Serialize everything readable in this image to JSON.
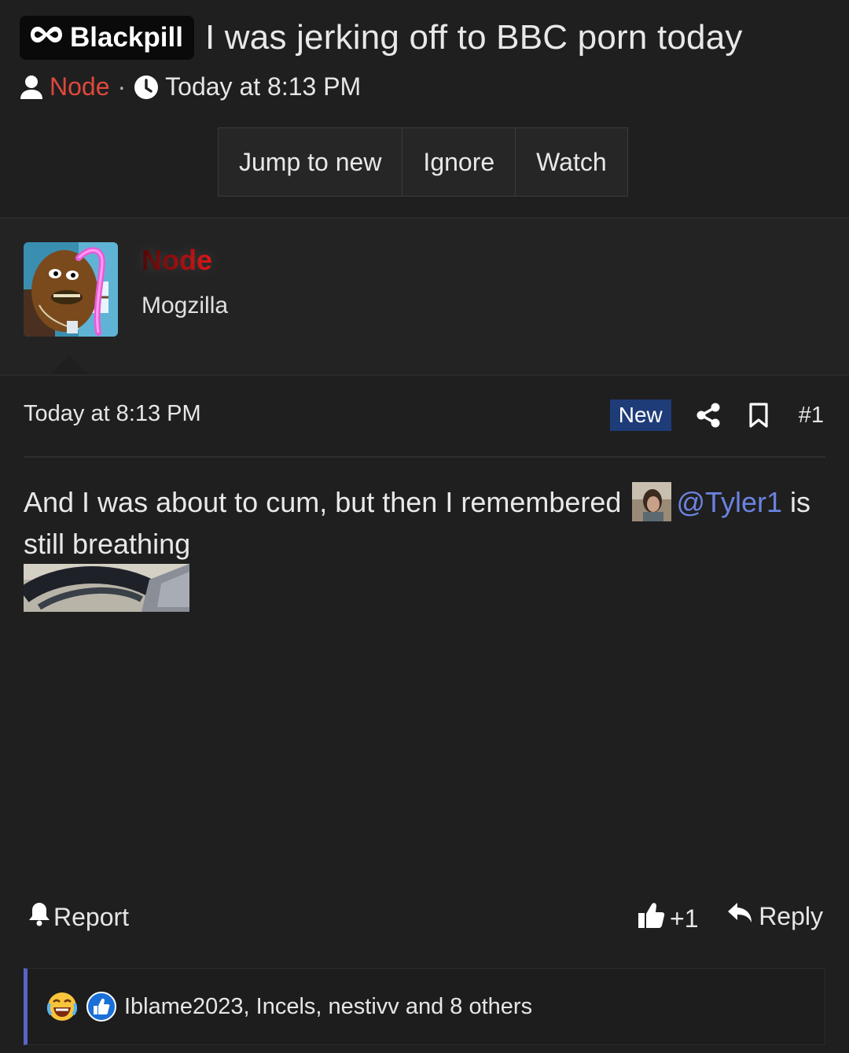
{
  "thread": {
    "prefix": "Blackpill",
    "title": "I was jerking off to BBC porn today",
    "author": "Node",
    "separator": "·",
    "time": "Today at 8:13 PM"
  },
  "buttons": {
    "jump": "Jump to new",
    "ignore": "Ignore",
    "watch": "Watch"
  },
  "author_block": {
    "name": "Node",
    "user_title": "Mogzilla"
  },
  "post": {
    "time": "Today at 8:13 PM",
    "new_badge": "New",
    "number": "#1",
    "text_before": "And I was about to cum, but then I remembered",
    "mention": "@Tyler1",
    "text_after": "is still breathing",
    "report": "Report",
    "like_count": "+1",
    "reply": "Reply",
    "reactions": "Iblame2023, Incels, nestivv and 8 others"
  },
  "colors": {
    "background": "#1f1f1f",
    "author_link": "#e0483c",
    "mention": "#6b83e0",
    "new_badge": "#1e3c78",
    "reaction_border": "#5b63c8"
  },
  "icons": [
    "infinity-logo-icon",
    "user-icon",
    "clock-icon",
    "share-icon",
    "bookmark-icon",
    "bell-icon",
    "thumbs-up-icon",
    "reply-icon",
    "laughing-crying-emoji-icon",
    "like-reaction-icon"
  ]
}
